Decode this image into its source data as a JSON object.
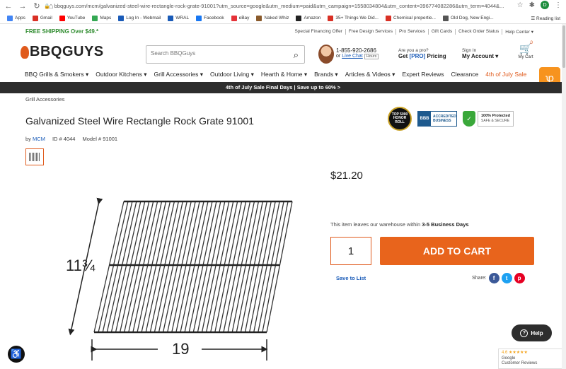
{
  "browser": {
    "url": "bbqguys.com/mcm/galvanized-steel-wire-rectangle-rock-grate-91001?utm_source=google&utm_medium=paid&utm_campaign=1558034804&utm_content=396774082286&utm_term=4044&...",
    "profile_initial": "D",
    "bookmarks": [
      "Apps",
      "Gmail",
      "YouTube",
      "Maps",
      "Log In - Webmail",
      "WRAL",
      "Facebook",
      "eBay",
      "Naked Whiz",
      "Amazon",
      "35+ Things We Did...",
      "Chemical propertie...",
      "Old Dog, New Engi..."
    ],
    "bookmark_colors": [
      "#4285f4",
      "#d93025",
      "#ff0000",
      "#34a853",
      "#1a5bb8",
      "#1a5bb8",
      "#1877f2",
      "#e53238",
      "#8a5a2b",
      "#222222",
      "#d93025",
      "#d93025",
      "#555555"
    ],
    "reading_list": "Reading list"
  },
  "topbar": {
    "free_shipping": "FREE SHIPPING Over $49.*",
    "links": [
      "Special Financing Offer",
      "Free Design Services",
      "Pro Services",
      "Gift Cards",
      "Check Order Status",
      "Help Center ▾"
    ]
  },
  "header": {
    "logo": "BBQGUYS",
    "search_placeholder": "Search BBQGuys",
    "phone": "1-855-920-2686",
    "or": "or",
    "live_chat": "Live Chat",
    "hours": "Hours",
    "pro_line1": "Are you a pro?",
    "pro_get": "Get",
    "pro_badge": "[PRO]",
    "pro_pricing": "Pricing",
    "signin_line1": "Sign In",
    "signin_line2": "My Account ▾",
    "cart_count": "0",
    "cart_label": "My Cart"
  },
  "nav": [
    "BBQ Grills & Smokers ▾",
    "Outdoor Kitchens ▾",
    "Grill Accessories ▾",
    "Outdoor Living ▾",
    "Hearth & Home ▾",
    "Brands ▾",
    "Articles & Videos ▾",
    "Expert Reviews",
    "Clearance",
    "4th of July Sale"
  ],
  "promo": "4th of July Sale Final Days | Save up to 60% >",
  "product": {
    "breadcrumb": "Grill Accessories",
    "title": "Galvanized Steel Wire Rectangle Rock Grate 91001",
    "by": "by",
    "brand": "MCM",
    "id": "ID # 4044",
    "model": "Model # 91001",
    "price": "$21.20",
    "ship_prefix": "This item leaves our warehouse within",
    "ship_days": "3-5 Business Days",
    "quantity": "1",
    "add_to_cart": "ADD TO CART",
    "save_to_list": "Save to List",
    "share_label": "Share:",
    "dim_height": "11¾",
    "dim_width": "19"
  },
  "badges": {
    "honor": "TOP 5000 HONOR ROLL",
    "bbb_line1": "ACCREDITED",
    "bbb_line2": "BUSINESS",
    "secure_line1": "100% Protected",
    "secure_line2": "SAFE & SECURE"
  },
  "widgets": {
    "help": "Help",
    "google_rating": "4.6 ★★★★★",
    "google_line1": "Google",
    "google_line2": "Customer Reviews"
  },
  "colors": {
    "accent": "#e8641c",
    "link": "#1a5bb8",
    "free_ship": "#2e8b2e",
    "promo_bg": "#2d2d2d"
  }
}
